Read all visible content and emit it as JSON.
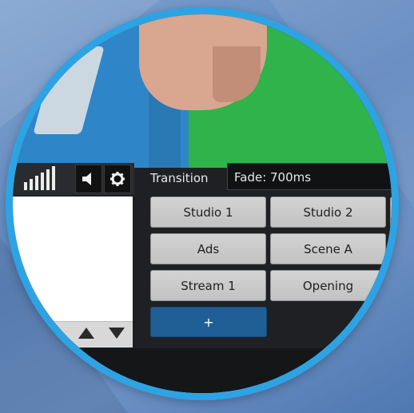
{
  "panel": {
    "transition_label": "Transition",
    "transition_value": "Fade: 700ms"
  },
  "toolbar": {
    "volume_icon": "speaker-icon",
    "settings_icon": "gear-icon",
    "level_icon": "audio-meter-icon"
  },
  "scenes": [
    {
      "label": "Studio 1"
    },
    {
      "label": "Studio 2"
    },
    {
      "label": "Ads"
    },
    {
      "label": "Scene A"
    },
    {
      "label": "Stream 1"
    },
    {
      "label": "Opening"
    }
  ],
  "add_button": {
    "label": "+"
  },
  "colors": {
    "ring": "#2ea3e3",
    "accent_button": "#1f5f96",
    "green_screen": "#2fb34a"
  }
}
